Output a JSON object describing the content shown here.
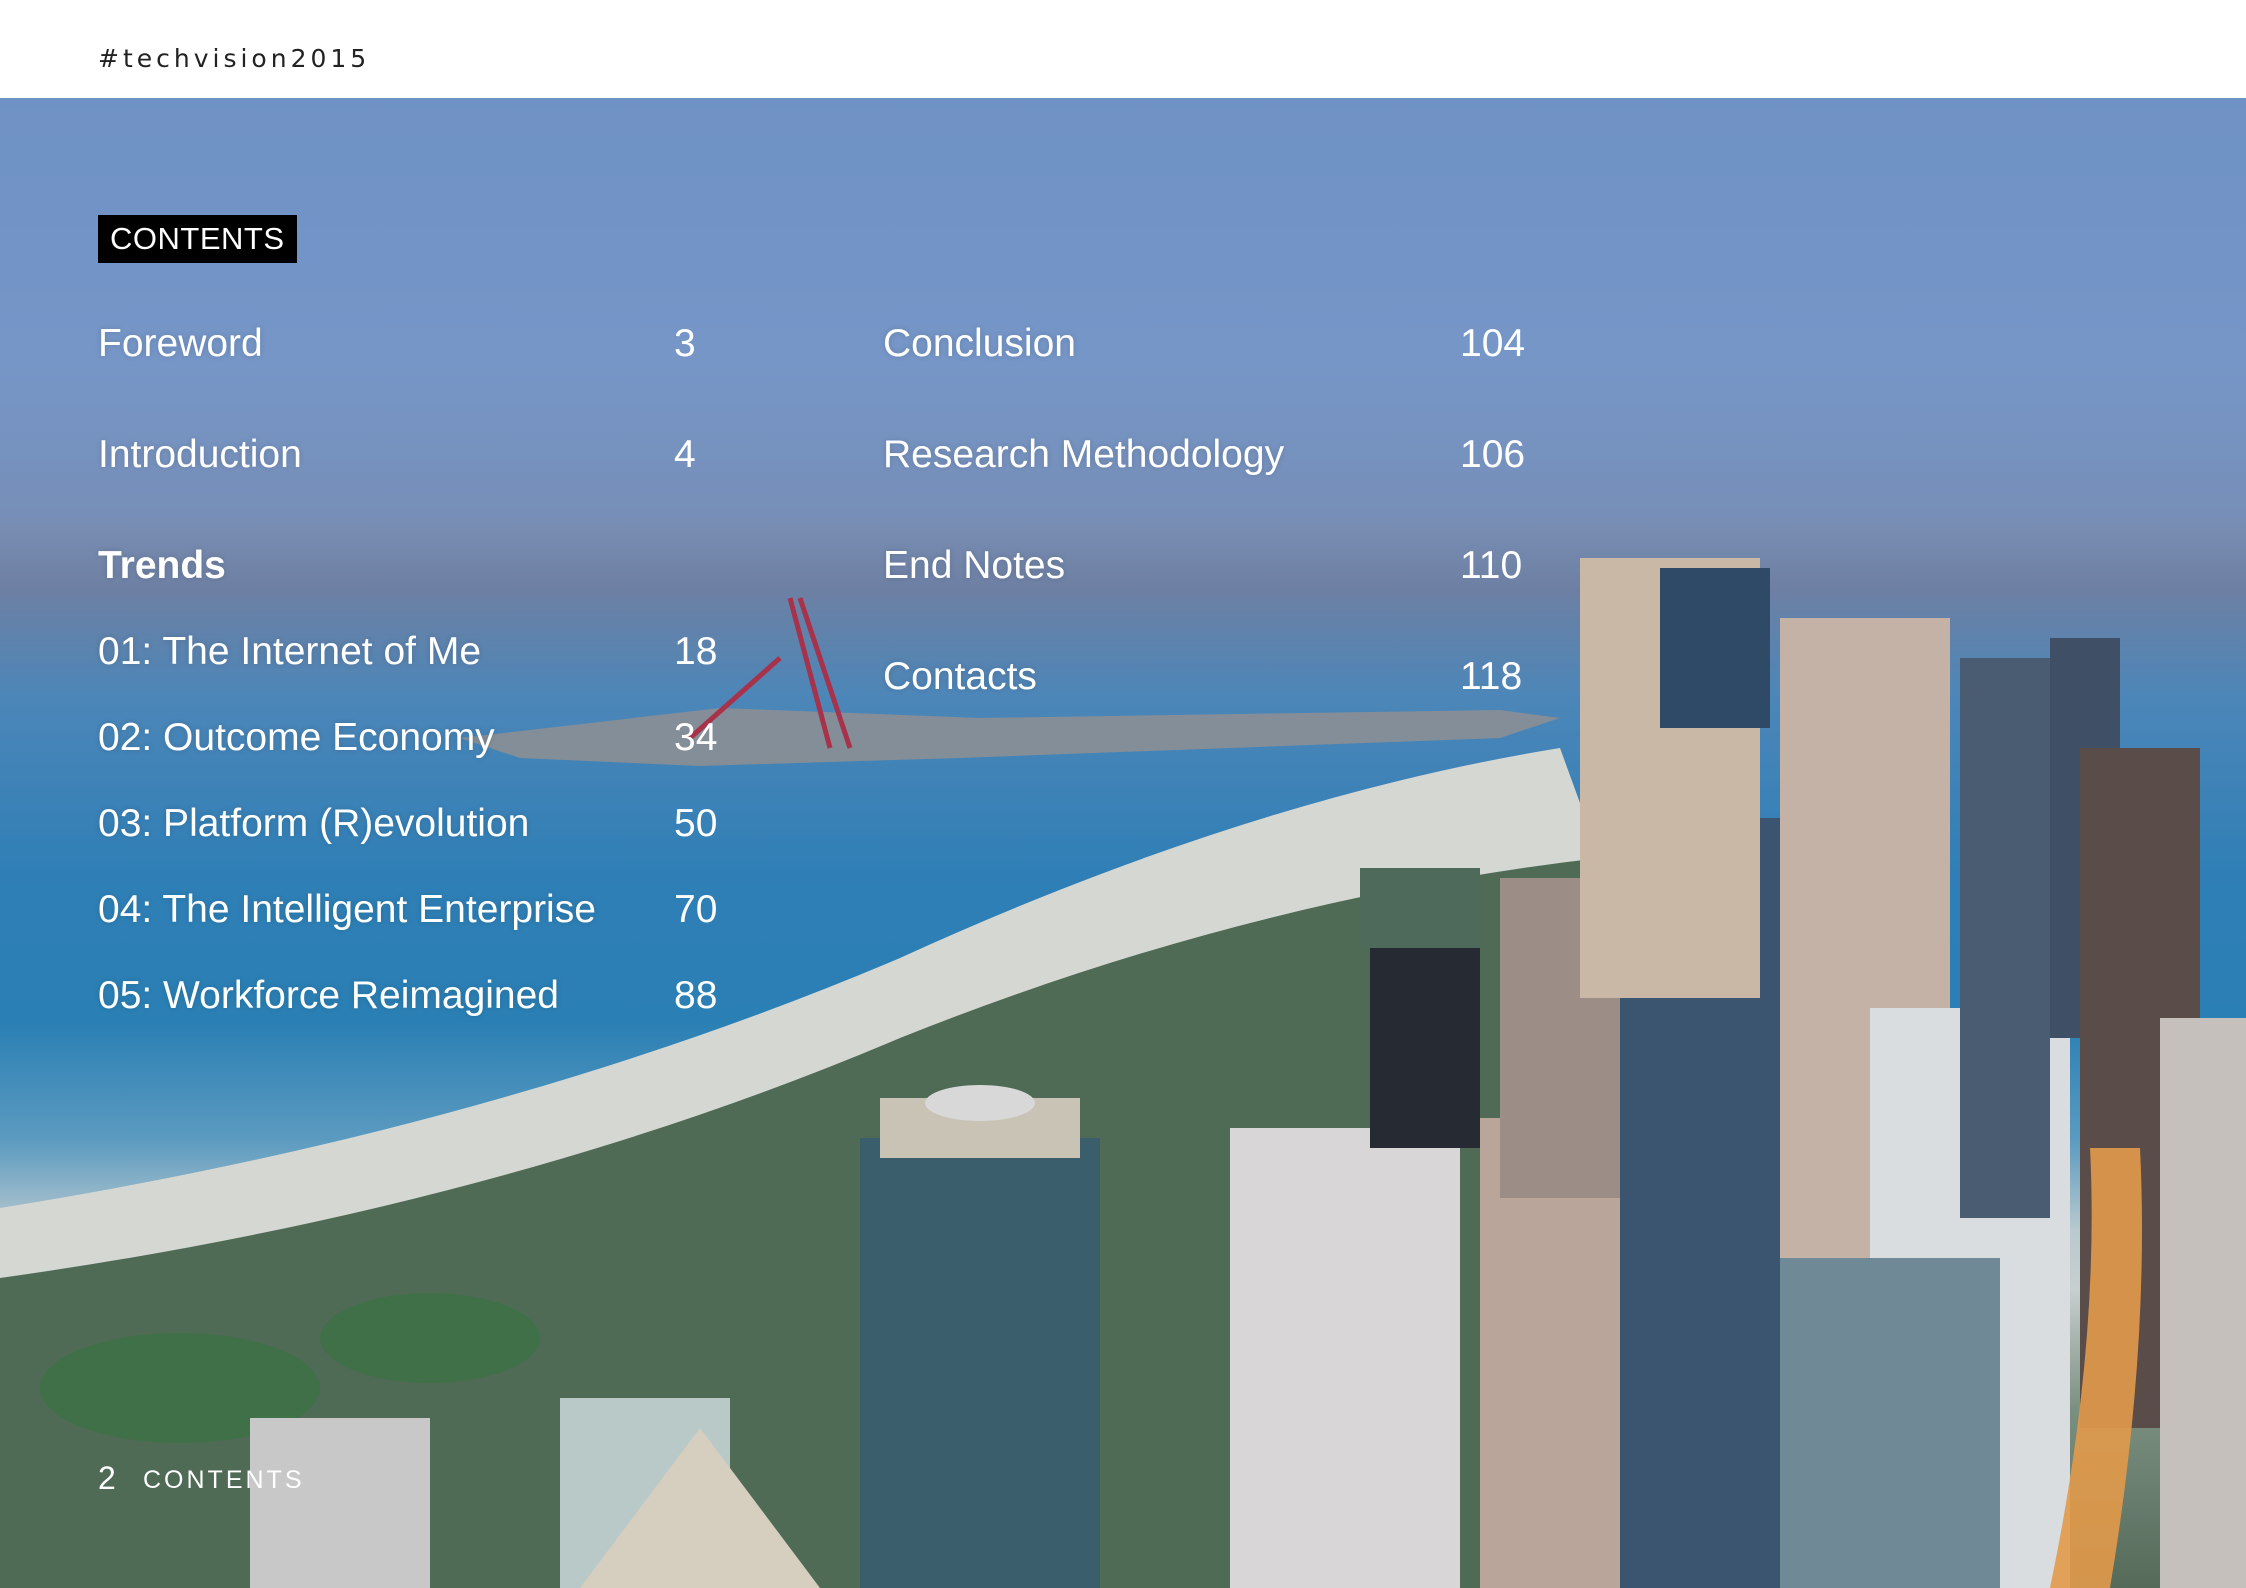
{
  "header": {
    "hashtag": "#techvision2015"
  },
  "contents_label": "CONTENTS",
  "toc_left": [
    {
      "label": "Foreword",
      "page": "3"
    },
    {
      "label": "Introduction",
      "page": "4"
    },
    {
      "label": "Trends",
      "page": ""
    },
    {
      "label": "01: The Internet of Me",
      "page": "18"
    },
    {
      "label": "02: Outcome Economy",
      "page": "34"
    },
    {
      "label": "03: Platform (R)evolution",
      "page": "50"
    },
    {
      "label": "04: The Intelligent Enterprise",
      "page": "70"
    },
    {
      "label": "05: Workforce Reimagined",
      "page": "88"
    }
  ],
  "toc_right": [
    {
      "label": "Conclusion",
      "page": "104"
    },
    {
      "label": "Research Methodology",
      "page": "106"
    },
    {
      "label": "End Notes",
      "page": "110"
    },
    {
      "label": "Contacts",
      "page": "118"
    }
  ],
  "footer": {
    "page_number": "2",
    "section": "CONTENTS"
  }
}
